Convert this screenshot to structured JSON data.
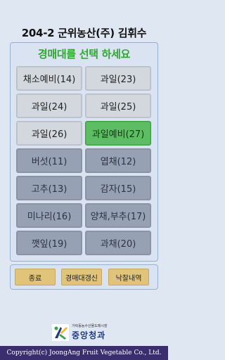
{
  "header": {
    "title": "204-2 군위농산(주) 김휘수"
  },
  "prompt": "경매대를 선택 하세요",
  "stalls": [
    {
      "label": "채소예비(14)",
      "state": "active"
    },
    {
      "label": "과일(23)",
      "state": "active"
    },
    {
      "label": "과일(24)",
      "state": "active"
    },
    {
      "label": "과일(25)",
      "state": "active"
    },
    {
      "label": "과일(26)",
      "state": "active"
    },
    {
      "label": "과일예비(27)",
      "state": "selected"
    },
    {
      "label": "버섯(11)",
      "state": "disabled"
    },
    {
      "label": "엽채(12)",
      "state": "disabled"
    },
    {
      "label": "고추(13)",
      "state": "disabled"
    },
    {
      "label": "감자(15)",
      "state": "disabled"
    },
    {
      "label": "미나리(16)",
      "state": "disabled"
    },
    {
      "label": "양채,부추(17)",
      "state": "disabled"
    },
    {
      "label": "깻잎(19)",
      "state": "disabled"
    },
    {
      "label": "과채(20)",
      "state": "disabled"
    }
  ],
  "buttons": {
    "exit": "종료",
    "refresh": "경매대갱신",
    "history": "낙찰내역"
  },
  "logo": {
    "subtitle": "가락동농수산물도매시장",
    "name": "중앙청과"
  },
  "footer": {
    "copyright": "Copyright(c) JoongAng Fruit Vegetable Co., Ltd."
  },
  "colors": {
    "selected": "#5cbd62",
    "active": "#d3d7de",
    "disabled": "#96a1b3",
    "button": "#e0c47a",
    "prompt": "#2ea82e",
    "footer": "#3a2e6e"
  }
}
